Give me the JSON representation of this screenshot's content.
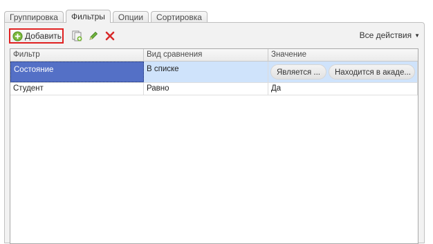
{
  "tabs": [
    {
      "label": "Группировка",
      "active": false
    },
    {
      "label": "Фильтры",
      "active": true
    },
    {
      "label": "Опции",
      "active": false
    },
    {
      "label": "Сортировка",
      "active": false
    }
  ],
  "toolbar": {
    "add_label": "Добавить",
    "add_icon": "plus-circle-icon",
    "copy_icon": "copy-icon",
    "edit_icon": "pencil-icon",
    "delete_icon": "delete-x-icon",
    "all_actions_label": "Все действия",
    "highlight_color": "#e02020"
  },
  "table": {
    "columns": [
      "Фильтр",
      "Вид сравнения",
      "Значение"
    ],
    "rows": [
      {
        "filter": "Состояние",
        "comparison": "В списке",
        "values": [
          "Является ...",
          "Находится в акаде..."
        ],
        "selected": true
      },
      {
        "filter": "Студент",
        "comparison": "Равно",
        "value": "Да",
        "selected": false
      }
    ]
  },
  "colors": {
    "selected_cell": "#5470c6",
    "selected_row": "#cfe3fb"
  }
}
